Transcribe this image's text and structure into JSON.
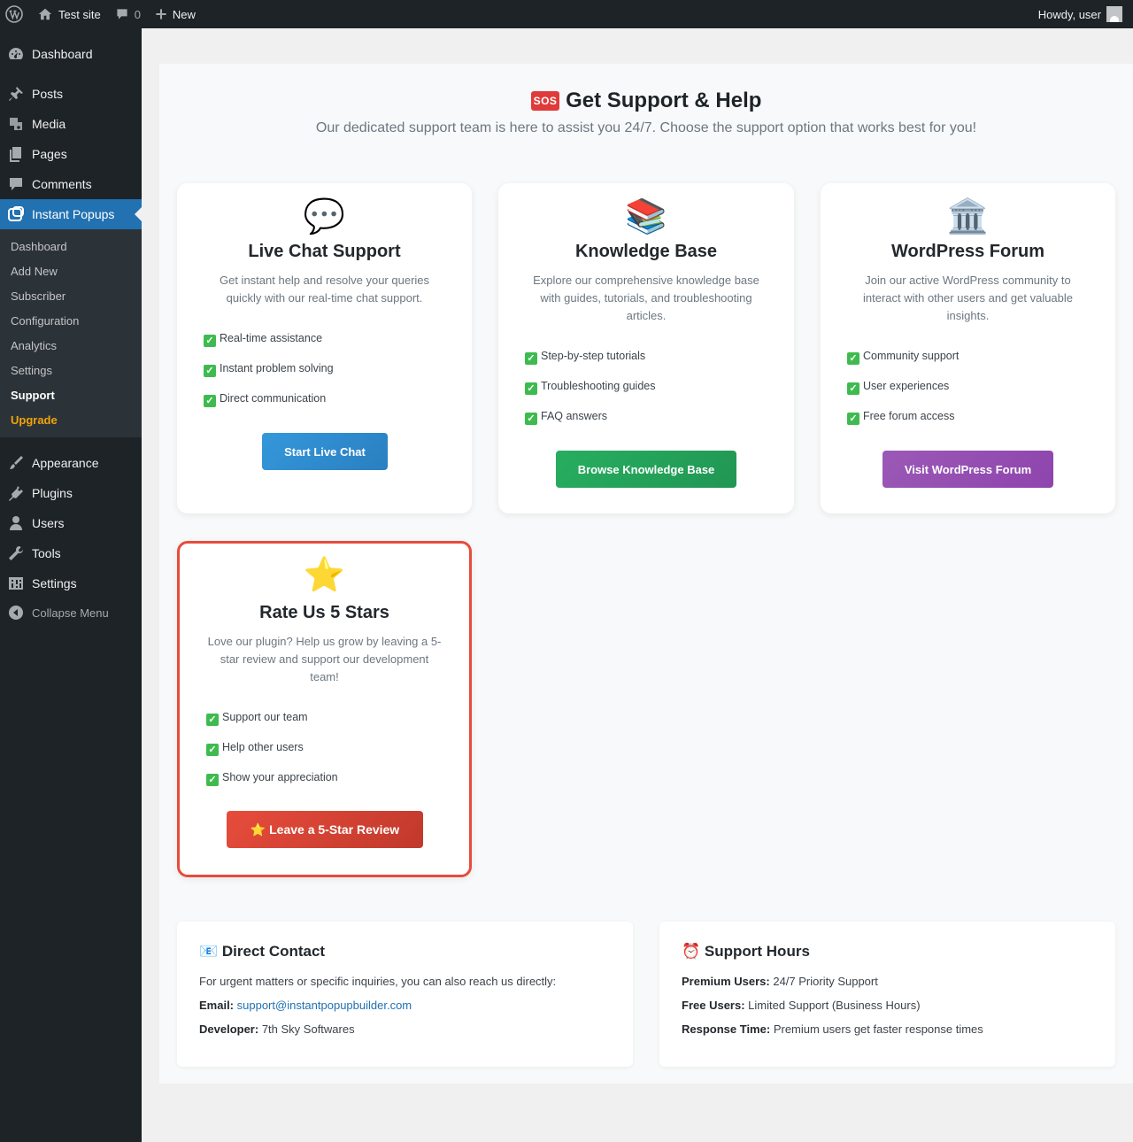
{
  "adminbar": {
    "site_name": "Test site",
    "comments_count": "0",
    "new_label": "New",
    "howdy": "Howdy, user"
  },
  "sidebar": {
    "items": [
      {
        "label": "Dashboard",
        "icon": "dashboard-icon"
      },
      {
        "label": "Posts",
        "icon": "pin-icon"
      },
      {
        "label": "Media",
        "icon": "media-icon"
      },
      {
        "label": "Pages",
        "icon": "pages-icon"
      },
      {
        "label": "Comments",
        "icon": "comment-icon"
      },
      {
        "label": "Instant Popups",
        "icon": "popup-icon"
      },
      {
        "label": "Appearance",
        "icon": "brush-icon"
      },
      {
        "label": "Plugins",
        "icon": "plug-icon"
      },
      {
        "label": "Users",
        "icon": "user-icon"
      },
      {
        "label": "Tools",
        "icon": "wrench-icon"
      },
      {
        "label": "Settings",
        "icon": "settings-icon"
      },
      {
        "label": "Collapse Menu",
        "icon": "collapse-icon"
      }
    ],
    "submenu": [
      "Dashboard",
      "Add New",
      "Subscriber",
      "Configuration",
      "Analytics",
      "Settings",
      "Support",
      "Upgrade"
    ]
  },
  "header": {
    "sos_badge": "SOS",
    "title": "Get Support & Help",
    "subtitle": "Our dedicated support team is here to assist you 24/7. Choose the support option that works best for you!"
  },
  "cards": [
    {
      "emoji": "💬",
      "title": "Live Chat Support",
      "description": "Get instant help and resolve your queries quickly with our real-time chat support.",
      "features": [
        "Real-time assistance",
        "Instant problem solving",
        "Direct communication"
      ],
      "button": "Start Live Chat"
    },
    {
      "emoji": "📚",
      "title": "Knowledge Base",
      "description": "Explore our comprehensive knowledge base with guides, tutorials, and troubleshooting articles.",
      "features": [
        "Step-by-step tutorials",
        "Troubleshooting guides",
        "FAQ answers"
      ],
      "button": "Browse Knowledge Base"
    },
    {
      "emoji": "🏛️",
      "title": "WordPress Forum",
      "description": "Join our active WordPress community to interact with other users and get valuable insights.",
      "features": [
        "Community support",
        "User experiences",
        "Free forum access"
      ],
      "button": "Visit WordPress Forum"
    },
    {
      "emoji": "⭐",
      "title": "Rate Us 5 Stars",
      "description": "Love our plugin? Help us grow by leaving a 5-star review and support our development team!",
      "features": [
        "Support our team",
        "Help other users",
        "Show your appreciation"
      ],
      "button": "⭐ Leave a 5-Star Review"
    }
  ],
  "contact": {
    "emoji": "📧",
    "title": "Direct Contact",
    "intro": "For urgent matters or specific inquiries, you can also reach us directly:",
    "email_label": "Email:",
    "email": "support@instantpopupbuilder.com",
    "developer_label": "Developer:",
    "developer": "7th Sky Softwares"
  },
  "hours": {
    "emoji": "⏰",
    "title": "Support Hours",
    "premium_label": "Premium Users:",
    "premium": "24/7 Priority Support",
    "free_label": "Free Users:",
    "free": "Limited Support (Business Hours)",
    "response_label": "Response Time:",
    "response": "Premium users get faster response times"
  },
  "colors": {
    "sidebar_bg": "#1d2327",
    "accent": "#2271b1",
    "featured_border": "#e74c3c",
    "upgrade": "#f0a30a"
  }
}
